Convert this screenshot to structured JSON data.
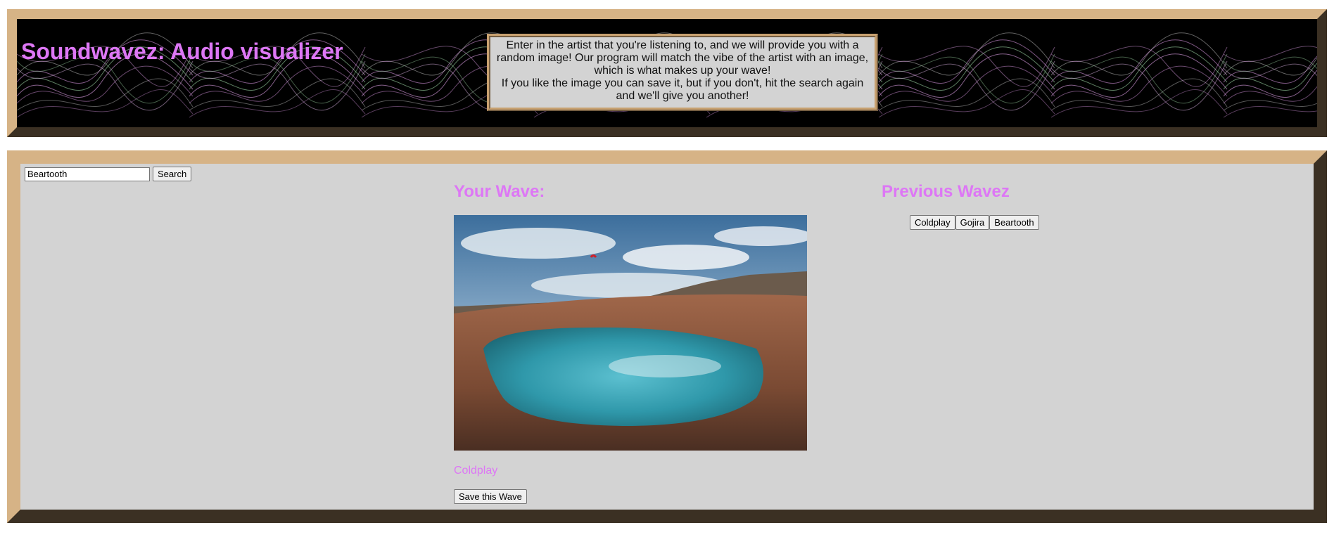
{
  "header": {
    "title": "Soundwavez: Audio visualizer",
    "intro_line_1": "Enter in the artist that you're listening to, and we will provide you with a random image! Our program will match the vibe of the artist with an image, which is what makes up your wave!",
    "intro_line_2": "If you like the image you can save it, but if you don't, hit the search again and we'll give you another!"
  },
  "search": {
    "value": "Beartooth",
    "button_label": "Search"
  },
  "wave": {
    "heading": "Your Wave:",
    "artist": "Coldplay",
    "save_label": "Save this Wave"
  },
  "previous": {
    "heading": "Previous Wavez",
    "items": [
      {
        "label": "Coldplay"
      },
      {
        "label": "Gojira"
      },
      {
        "label": "Beartooth"
      }
    ]
  },
  "colors": {
    "accent": "#dd77f5",
    "frame": "#c8a170",
    "panel": "#d3d3d3"
  }
}
